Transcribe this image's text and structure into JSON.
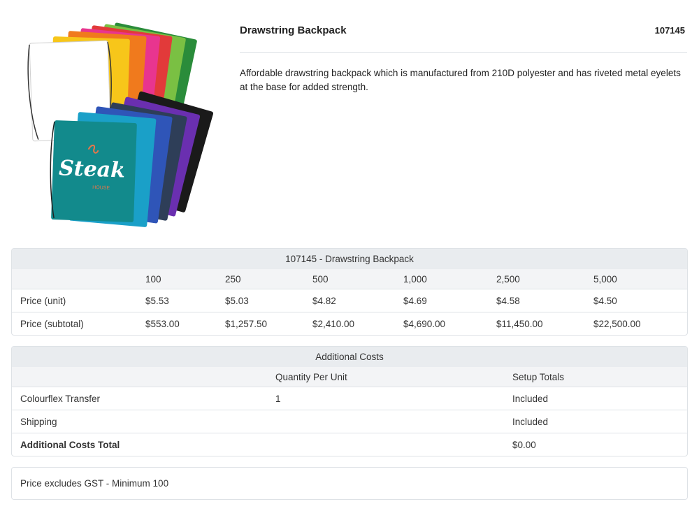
{
  "product": {
    "title": "Drawstring Backpack",
    "code": "107145",
    "description": "Affordable drawstring backpack which is manufactured from 210D polyester and has riveted metal eyelets at the base for added strength.",
    "logo_text": "Steak",
    "logo_sub": "HOUSE",
    "bag_colors": [
      "#2a8c3a",
      "#7ac043",
      "#e23a3a",
      "#e8358f",
      "#f07a1d",
      "#f7c61a",
      "#ffffff",
      "#1a1a1a",
      "#6a2fb0",
      "#2e3e58",
      "#2f55b8",
      "#1aa0c8",
      "#128a8c"
    ]
  },
  "price_table": {
    "title": "107145 - Drawstring Backpack",
    "quantities": [
      "100",
      "250",
      "500",
      "1,000",
      "2,500",
      "5,000"
    ],
    "rows": [
      {
        "label": "Price (unit)",
        "values": [
          "$5.53",
          "$5.03",
          "$4.82",
          "$4.69",
          "$4.58",
          "$4.50"
        ]
      },
      {
        "label": "Price (subtotal)",
        "values": [
          "$553.00",
          "$1,257.50",
          "$2,410.00",
          "$4,690.00",
          "$11,450.00",
          "$22,500.00"
        ]
      }
    ]
  },
  "costs_table": {
    "title": "Additional Costs",
    "headers": [
      "",
      "Quantity Per Unit",
      "Setup Totals"
    ],
    "rows": [
      {
        "label": "Colourflex Transfer",
        "qty": "1",
        "setup": "Included"
      },
      {
        "label": "Shipping",
        "qty": "",
        "setup": "Included"
      },
      {
        "label": "Additional Costs Total",
        "qty": "",
        "setup": "$0.00"
      }
    ]
  },
  "note": "Price excludes GST - Minimum 100"
}
